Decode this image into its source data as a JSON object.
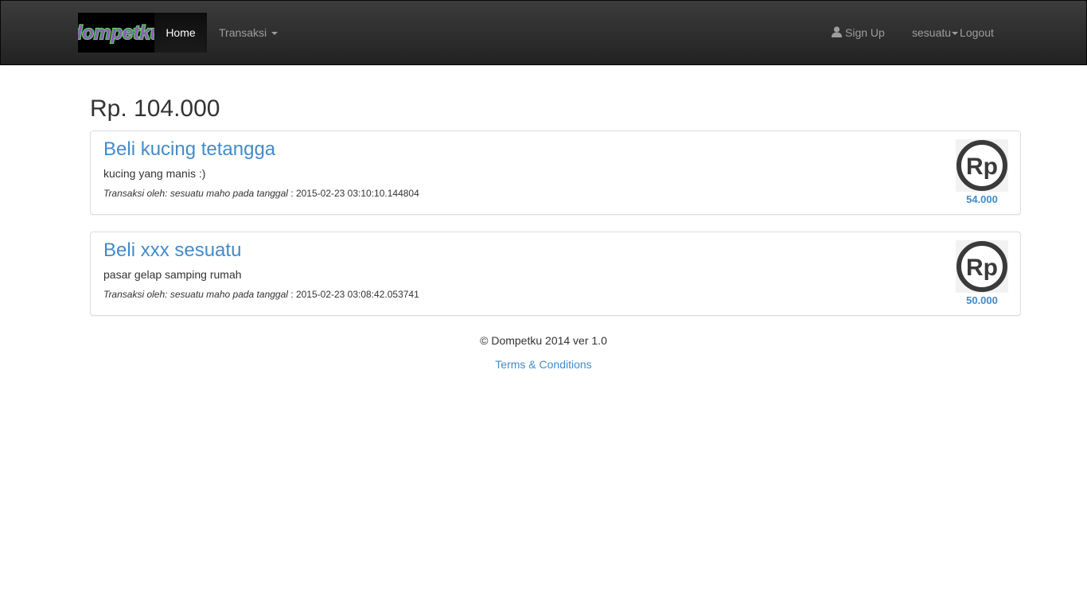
{
  "navbar": {
    "brand_text": "dompetku",
    "home_label": "Home",
    "transaksi_label": "Transaksi",
    "signup_label": "Sign Up",
    "user_label": "sesuatu",
    "logout_label": "Logout"
  },
  "balance": "Rp. 104.000",
  "transactions": [
    {
      "title": "Beli kucing tetangga",
      "description": "kucing yang manis :)",
      "meta_prefix": "Transaksi oleh: sesuatu maho pada tanggal",
      "meta_sep": " : ",
      "timestamp": "2015-02-23 03:10:10.144804",
      "icon_text": "Rp",
      "amount": "54.000"
    },
    {
      "title": "Beli xxx sesuatu",
      "description": "pasar gelap samping rumah",
      "meta_prefix": "Transaksi oleh: sesuatu maho pada tanggal",
      "meta_sep": " : ",
      "timestamp": "2015-02-23 03:08:42.053741",
      "icon_text": "Rp",
      "amount": "50.000"
    }
  ],
  "footer": {
    "copyright": "© Dompetku 2014 ver 1.0",
    "terms_label": "Terms & Conditions"
  },
  "colors": {
    "accent": "#428bca",
    "navbar_bg": "#222222",
    "logo_green": "#5fd35f",
    "logo_purple": "#8a5fb8"
  }
}
